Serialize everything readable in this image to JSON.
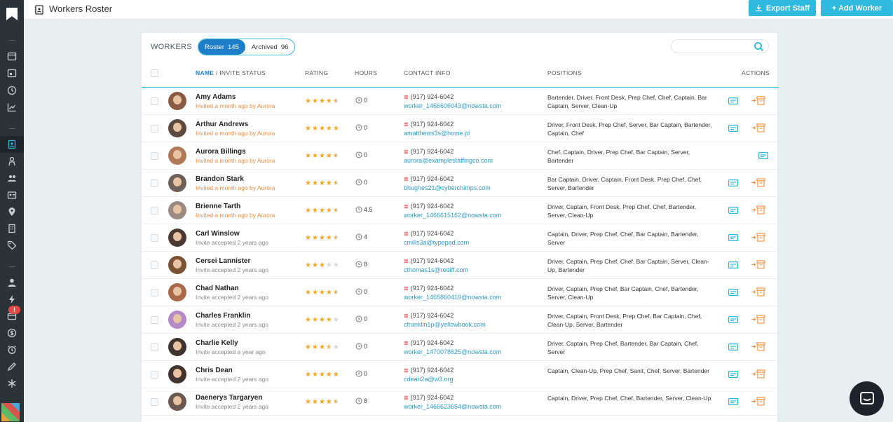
{
  "topbar": {
    "title": "Workers Roster",
    "export_label": "Export Staff",
    "add_label": "+ Add Worker"
  },
  "card": {
    "workers_label": "WORKERS",
    "roster_label": "Roster",
    "roster_count": "145",
    "archived_label": "Archived",
    "archived_count": "96",
    "search_placeholder": ""
  },
  "columns": {
    "name": "NAME",
    "invite": "/ INVITE STATUS",
    "rating": "RATING",
    "hours": "HOURS",
    "contact": "CONTACT INFO",
    "positions": "POSITIONS",
    "actions": "ACTIONS"
  },
  "sidebar": {
    "badge": "!"
  },
  "colors": {
    "accent": "#2fb9df",
    "active_tab": "#1e7fc8",
    "sidebar": "#2b3238",
    "invite_orange": "#f08a3a",
    "star": "#f5a623"
  },
  "rows": [
    {
      "name": "Amy Adams",
      "invite": "Invited a month ago by Aurora",
      "invite_pending": true,
      "rating": 4.5,
      "hours": "0",
      "phone": "(917) 924-6042",
      "email": "worker_1466606043@nowsta.com",
      "positions": "Bartender, Driver, Front Desk, Prep Chef, Chef, Captain, Bar Captain, Server, Clean-Up",
      "archive_action": true
    },
    {
      "name": "Arthur Andrews",
      "invite": "Invited a month ago by Aurora",
      "invite_pending": true,
      "rating": 5,
      "hours": "0",
      "phone": "(917) 924-6042",
      "email": "amatthews3s@home.pl",
      "positions": "Driver, Front Desk, Prep Chef, Server, Bar Captain, Bartender, Captain, Chef",
      "archive_action": true
    },
    {
      "name": "Aurora Billings",
      "invite": "Invited a month ago by Aurora",
      "invite_pending": true,
      "rating": 4.5,
      "hours": "0",
      "phone": "(917) 924-6042",
      "email": "aurora@examplestaffingco.com",
      "positions": "Chef, Captain, Driver, Prep Chef, Bar Captain, Server, Bartender",
      "archive_action": false
    },
    {
      "name": "Brandon Stark",
      "invite": "Invited a month ago by Aurora",
      "invite_pending": true,
      "rating": 4.5,
      "hours": "0",
      "phone": "(917) 924-6042",
      "email": "bhughes21@cyberchimps.com",
      "positions": "Bar Captain, Driver, Captain, Front Desk, Prep Chef, Chef, Server, Bartender",
      "archive_action": true
    },
    {
      "name": "Brienne Tarth",
      "invite": "Invited a month ago by Aurora",
      "invite_pending": true,
      "rating": 4.5,
      "hours": "4.5",
      "phone": "(917) 924-6042",
      "email": "worker_1466615162@nowsta.com",
      "positions": "Driver, Captain, Front Desk, Prep Chef, Chef, Bartender, Server, Clean-Up",
      "archive_action": true
    },
    {
      "name": "Carl Winslow",
      "invite": "Invite accepted 2 years ago",
      "invite_pending": false,
      "rating": 4.5,
      "hours": "4",
      "phone": "(917) 924-6042",
      "email": "cmills3a@typepad.com",
      "positions": "Captain, Driver, Prep Chef, Chef, Bar Captain, Bartender, Server",
      "archive_action": true
    },
    {
      "name": "Cersei Lannister",
      "invite": "Invite accepted 2 years ago",
      "invite_pending": false,
      "rating": 3,
      "hours": "8",
      "phone": "(917) 924-6042",
      "email": "cthomas1s@rediff.com",
      "positions": "Driver, Captain, Prep Chef, Chef, Bar Captain, Server, Clean-Up, Bartender",
      "archive_action": true
    },
    {
      "name": "Chad Nathan",
      "invite": "Invite accepted 2 years ago",
      "invite_pending": false,
      "rating": 4.5,
      "hours": "0",
      "phone": "(917) 924-6042",
      "email": "worker_1465860419@nowsta.com",
      "positions": "Driver, Captain, Prep Chef, Bar Captain, Chef, Bartender, Server, Clean-Up",
      "archive_action": true
    },
    {
      "name": "Charles Franklin",
      "invite": "Invite accepted 2 years ago",
      "invite_pending": false,
      "rating": 4,
      "hours": "0",
      "phone": "(917) 924-6042",
      "email": "cfranklin1p@yellowbook.com",
      "positions": "Driver, Captain, Front Desk, Prep Chef, Bar Captain, Chef, Clean-Up, Server, Bartender",
      "archive_action": true
    },
    {
      "name": "Charlie Kelly",
      "invite": "Invite accepted a year ago",
      "invite_pending": false,
      "rating": 3.5,
      "hours": "0",
      "phone": "(917) 924-6042",
      "email": "worker_1470078625@nowsta.com",
      "positions": "Driver, Captain, Prep Chef, Bartender, Bar Captain, Chef, Server",
      "archive_action": true
    },
    {
      "name": "Chris Dean",
      "invite": "Invite accepted 2 years ago",
      "invite_pending": false,
      "rating": 5,
      "hours": "0",
      "phone": "(917) 924-6042",
      "email": "cdean2a@w3.org",
      "positions": "Captain, Clean-Up, Prep Chef, Sanit, Chef, Server, Bartender",
      "archive_action": true
    },
    {
      "name": "Daenerys Targaryen",
      "invite": "Invite accepted 2 years ago",
      "invite_pending": false,
      "rating": 4.5,
      "hours": "8",
      "phone": "(917) 924-6042",
      "email": "worker_1466623654@nowsta.com",
      "positions": "Captain, Driver, Prep Chef, Chef, Bartender, Server, Clean-Up",
      "archive_action": true
    }
  ]
}
